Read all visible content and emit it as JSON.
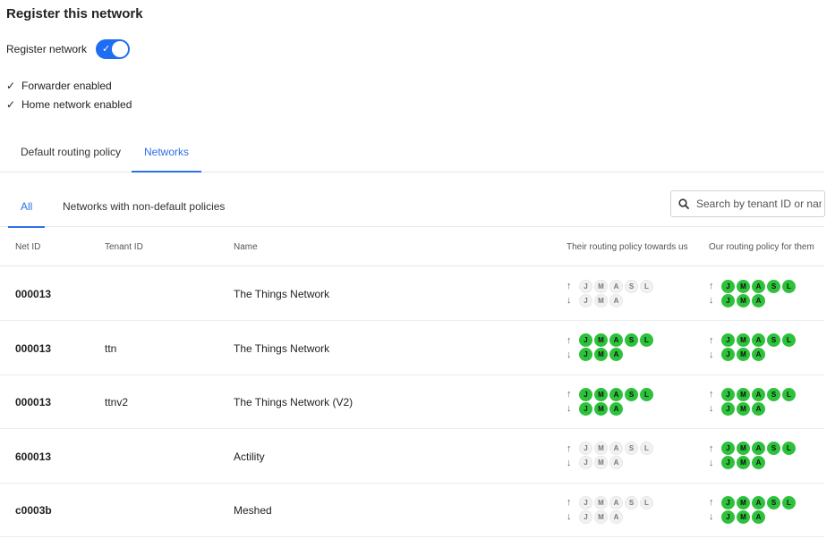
{
  "header": {
    "title": "Register this network"
  },
  "register": {
    "label": "Register network",
    "enabled": true,
    "check": "✓"
  },
  "status": [
    {
      "check": "✓",
      "label": "Forwarder enabled"
    },
    {
      "check": "✓",
      "label": "Home network enabled"
    }
  ],
  "tabs": [
    {
      "label": "Default routing policy",
      "active": false
    },
    {
      "label": "Networks",
      "active": true
    }
  ],
  "subtabs": [
    {
      "label": "All",
      "active": true
    },
    {
      "label": "Networks with non-default policies",
      "active": false
    }
  ],
  "search": {
    "placeholder": "Search by tenant ID or name",
    "value": ""
  },
  "table": {
    "columns": [
      "Net ID",
      "Tenant ID",
      "Name",
      "Their routing policy towards us",
      "Our routing policy for them"
    ],
    "arrows": {
      "up": "↑",
      "down": "↓"
    },
    "up_letters": [
      "J",
      "M",
      "A",
      "S",
      "L"
    ],
    "down_letters": [
      "J",
      "M",
      "A"
    ],
    "rows": [
      {
        "net_id": "000013",
        "tenant_id": "",
        "name": "The Things Network",
        "their_policy_active": false,
        "our_policy_active": true
      },
      {
        "net_id": "000013",
        "tenant_id": "ttn",
        "name": "The Things Network",
        "their_policy_active": true,
        "our_policy_active": true
      },
      {
        "net_id": "000013",
        "tenant_id": "ttnv2",
        "name": "The Things Network (V2)",
        "their_policy_active": true,
        "our_policy_active": true
      },
      {
        "net_id": "600013",
        "tenant_id": "",
        "name": "Actility",
        "their_policy_active": false,
        "our_policy_active": true
      },
      {
        "net_id": "c0003b",
        "tenant_id": "",
        "name": "Meshed",
        "their_policy_active": false,
        "our_policy_active": true
      }
    ]
  },
  "colors": {
    "accent": "#2f6fe8",
    "toggle": "#1f6df2",
    "policy_on": "#2ec13b",
    "policy_off": "#f1f1f1"
  }
}
